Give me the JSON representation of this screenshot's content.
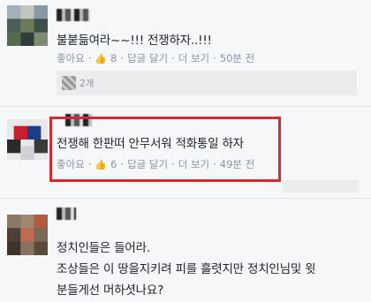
{
  "comments": [
    {
      "text": "불붙듦여라~~!!! 전쟁하자..!!!",
      "like_label": "좋아요",
      "like_count": "8",
      "reply_label": "답글 달기",
      "more_label": "더 보기",
      "time": "50분 전",
      "replies_count": "2개"
    },
    {
      "text": "전쟁해 한판떠 안무서워 적화통일 하자",
      "like_label": "좋아요",
      "like_count": "6",
      "reply_label": "답글 달기",
      "more_label": "더 보기",
      "time": "49분 전"
    },
    {
      "line1": "정치인들은 들어라.",
      "line2": "조상들은 이 땅을지키려 피를 흘렷지만 정치인님및 윗",
      "line3": "분들게선 머하셧나요?"
    }
  ],
  "colors": {
    "highlight_border": "#d7282f",
    "meta_text": "#8a94a6",
    "like_icon": "#5b7bd5"
  },
  "icons": {
    "like": "thumbs-up-icon"
  }
}
